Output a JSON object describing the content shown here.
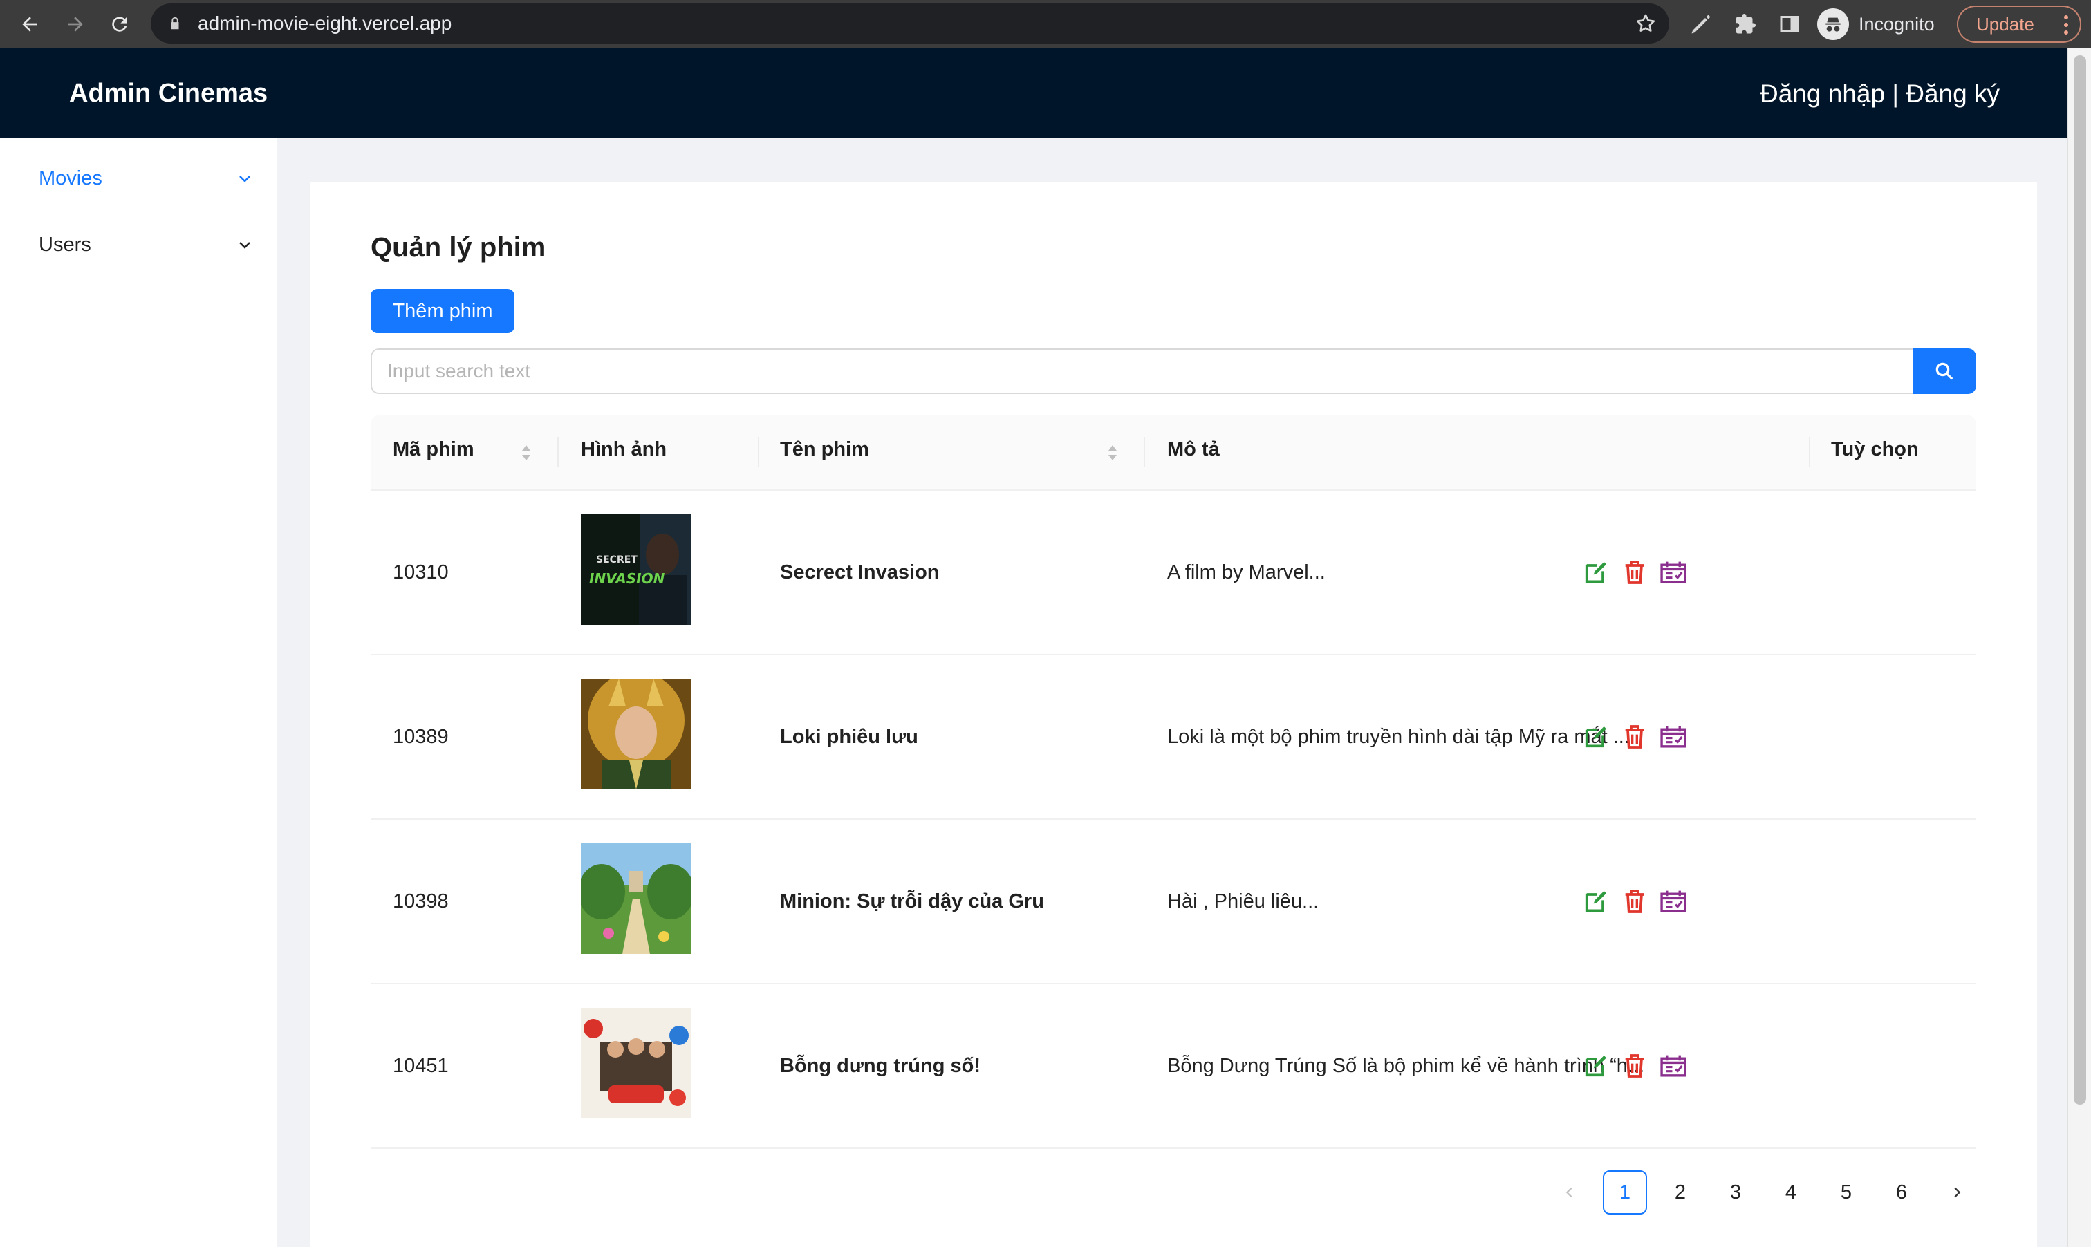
{
  "browser": {
    "url": "admin-movie-eight.vercel.app",
    "profile_label": "Incognito",
    "update_label": "Update"
  },
  "header": {
    "title": "Admin Cinemas",
    "auth_text": "Đăng nhập | Đăng ký"
  },
  "sidebar": {
    "items": [
      {
        "label": "Movies",
        "active": true
      },
      {
        "label": "Users",
        "active": false
      }
    ]
  },
  "main": {
    "page_title": "Quản lý phim",
    "add_button_label": "Thêm phim",
    "search_placeholder": "Input search text",
    "search_value": ""
  },
  "table": {
    "columns": [
      "Mã phim",
      "Hình ảnh",
      "Tên phim",
      "Mô tả",
      "Tuỳ chọn"
    ],
    "rows": [
      {
        "id": "10310",
        "name": "Secrect Invasion",
        "description": "A film by Marvel..."
      },
      {
        "id": "10389",
        "name": "Loki phiêu lưu",
        "description": "Loki là một bộ phim truyền hình dài tập Mỹ ra mắt ..."
      },
      {
        "id": "10398",
        "name": "Minion: Sự trỗi dậy của Gru",
        "description": "Hài , Phiêu liêu..."
      },
      {
        "id": "10451",
        "name": "Bỗng dưng trúng số!",
        "description": "Bỗng Dưng Trúng Số là bộ phim kể về hành trình “h..."
      }
    ]
  },
  "pagination": {
    "pages": [
      "1",
      "2",
      "3",
      "4",
      "5",
      "6"
    ],
    "current": "1"
  },
  "colors": {
    "header_bg": "#001529",
    "primary": "#1677ff",
    "edit_icon": "#2e9a3e",
    "delete_icon": "#e0362c",
    "schedule_icon": "#8b2f8f"
  }
}
